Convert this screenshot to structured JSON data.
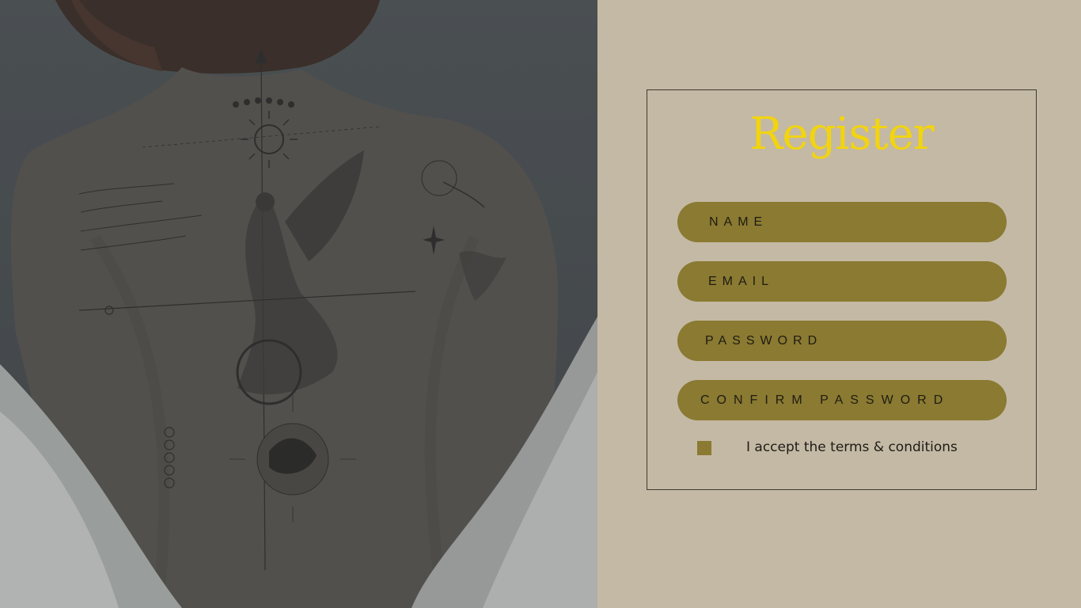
{
  "form": {
    "title": "Register",
    "fields": {
      "name_placeholder": "NAME",
      "email_placeholder": "EMAIL",
      "password_placeholder": "PASSWORD",
      "confirm_password_placeholder": "CONFIRM PASSWORD"
    },
    "terms": {
      "label": "I accept the terms & conditions",
      "checked": false
    }
  },
  "colors": {
    "background": "#c4b9a4",
    "title": "#f2d40f",
    "field_fill": "#8a7a32",
    "border": "#3d3a33",
    "photo_overlay": "#4a4f52"
  },
  "hero_image": {
    "subject": "back tattoo photo",
    "icon": "image-photo"
  }
}
